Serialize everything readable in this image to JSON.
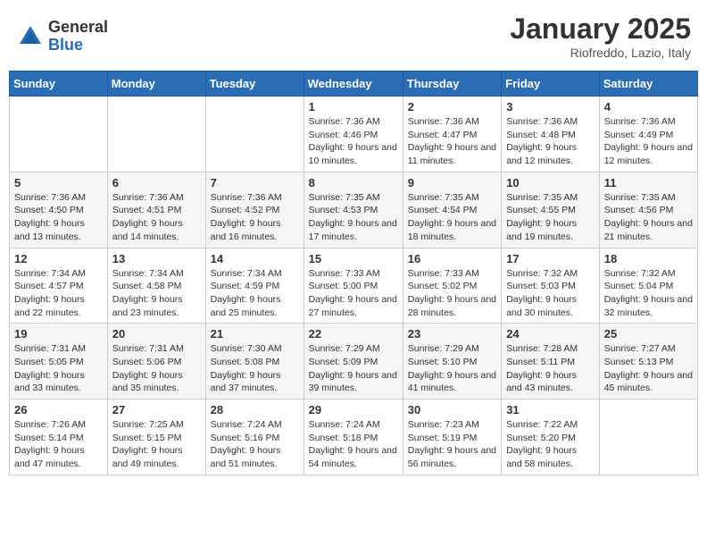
{
  "header": {
    "logo_general": "General",
    "logo_blue": "Blue",
    "month_title": "January 2025",
    "location": "Riofreddo, Lazio, Italy"
  },
  "weekdays": [
    "Sunday",
    "Monday",
    "Tuesday",
    "Wednesday",
    "Thursday",
    "Friday",
    "Saturday"
  ],
  "weeks": [
    [
      {
        "day": "",
        "sunrise": "",
        "sunset": "",
        "daylight": ""
      },
      {
        "day": "",
        "sunrise": "",
        "sunset": "",
        "daylight": ""
      },
      {
        "day": "",
        "sunrise": "",
        "sunset": "",
        "daylight": ""
      },
      {
        "day": "1",
        "sunrise": "Sunrise: 7:36 AM",
        "sunset": "Sunset: 4:46 PM",
        "daylight": "Daylight: 9 hours and 10 minutes."
      },
      {
        "day": "2",
        "sunrise": "Sunrise: 7:36 AM",
        "sunset": "Sunset: 4:47 PM",
        "daylight": "Daylight: 9 hours and 11 minutes."
      },
      {
        "day": "3",
        "sunrise": "Sunrise: 7:36 AM",
        "sunset": "Sunset: 4:48 PM",
        "daylight": "Daylight: 9 hours and 12 minutes."
      },
      {
        "day": "4",
        "sunrise": "Sunrise: 7:36 AM",
        "sunset": "Sunset: 4:49 PM",
        "daylight": "Daylight: 9 hours and 12 minutes."
      }
    ],
    [
      {
        "day": "5",
        "sunrise": "Sunrise: 7:36 AM",
        "sunset": "Sunset: 4:50 PM",
        "daylight": "Daylight: 9 hours and 13 minutes."
      },
      {
        "day": "6",
        "sunrise": "Sunrise: 7:36 AM",
        "sunset": "Sunset: 4:51 PM",
        "daylight": "Daylight: 9 hours and 14 minutes."
      },
      {
        "day": "7",
        "sunrise": "Sunrise: 7:36 AM",
        "sunset": "Sunset: 4:52 PM",
        "daylight": "Daylight: 9 hours and 16 minutes."
      },
      {
        "day": "8",
        "sunrise": "Sunrise: 7:35 AM",
        "sunset": "Sunset: 4:53 PM",
        "daylight": "Daylight: 9 hours and 17 minutes."
      },
      {
        "day": "9",
        "sunrise": "Sunrise: 7:35 AM",
        "sunset": "Sunset: 4:54 PM",
        "daylight": "Daylight: 9 hours and 18 minutes."
      },
      {
        "day": "10",
        "sunrise": "Sunrise: 7:35 AM",
        "sunset": "Sunset: 4:55 PM",
        "daylight": "Daylight: 9 hours and 19 minutes."
      },
      {
        "day": "11",
        "sunrise": "Sunrise: 7:35 AM",
        "sunset": "Sunset: 4:56 PM",
        "daylight": "Daylight: 9 hours and 21 minutes."
      }
    ],
    [
      {
        "day": "12",
        "sunrise": "Sunrise: 7:34 AM",
        "sunset": "Sunset: 4:57 PM",
        "daylight": "Daylight: 9 hours and 22 minutes."
      },
      {
        "day": "13",
        "sunrise": "Sunrise: 7:34 AM",
        "sunset": "Sunset: 4:58 PM",
        "daylight": "Daylight: 9 hours and 23 minutes."
      },
      {
        "day": "14",
        "sunrise": "Sunrise: 7:34 AM",
        "sunset": "Sunset: 4:59 PM",
        "daylight": "Daylight: 9 hours and 25 minutes."
      },
      {
        "day": "15",
        "sunrise": "Sunrise: 7:33 AM",
        "sunset": "Sunset: 5:00 PM",
        "daylight": "Daylight: 9 hours and 27 minutes."
      },
      {
        "day": "16",
        "sunrise": "Sunrise: 7:33 AM",
        "sunset": "Sunset: 5:02 PM",
        "daylight": "Daylight: 9 hours and 28 minutes."
      },
      {
        "day": "17",
        "sunrise": "Sunrise: 7:32 AM",
        "sunset": "Sunset: 5:03 PM",
        "daylight": "Daylight: 9 hours and 30 minutes."
      },
      {
        "day": "18",
        "sunrise": "Sunrise: 7:32 AM",
        "sunset": "Sunset: 5:04 PM",
        "daylight": "Daylight: 9 hours and 32 minutes."
      }
    ],
    [
      {
        "day": "19",
        "sunrise": "Sunrise: 7:31 AM",
        "sunset": "Sunset: 5:05 PM",
        "daylight": "Daylight: 9 hours and 33 minutes."
      },
      {
        "day": "20",
        "sunrise": "Sunrise: 7:31 AM",
        "sunset": "Sunset: 5:06 PM",
        "daylight": "Daylight: 9 hours and 35 minutes."
      },
      {
        "day": "21",
        "sunrise": "Sunrise: 7:30 AM",
        "sunset": "Sunset: 5:08 PM",
        "daylight": "Daylight: 9 hours and 37 minutes."
      },
      {
        "day": "22",
        "sunrise": "Sunrise: 7:29 AM",
        "sunset": "Sunset: 5:09 PM",
        "daylight": "Daylight: 9 hours and 39 minutes."
      },
      {
        "day": "23",
        "sunrise": "Sunrise: 7:29 AM",
        "sunset": "Sunset: 5:10 PM",
        "daylight": "Daylight: 9 hours and 41 minutes."
      },
      {
        "day": "24",
        "sunrise": "Sunrise: 7:28 AM",
        "sunset": "Sunset: 5:11 PM",
        "daylight": "Daylight: 9 hours and 43 minutes."
      },
      {
        "day": "25",
        "sunrise": "Sunrise: 7:27 AM",
        "sunset": "Sunset: 5:13 PM",
        "daylight": "Daylight: 9 hours and 45 minutes."
      }
    ],
    [
      {
        "day": "26",
        "sunrise": "Sunrise: 7:26 AM",
        "sunset": "Sunset: 5:14 PM",
        "daylight": "Daylight: 9 hours and 47 minutes."
      },
      {
        "day": "27",
        "sunrise": "Sunrise: 7:25 AM",
        "sunset": "Sunset: 5:15 PM",
        "daylight": "Daylight: 9 hours and 49 minutes."
      },
      {
        "day": "28",
        "sunrise": "Sunrise: 7:24 AM",
        "sunset": "Sunset: 5:16 PM",
        "daylight": "Daylight: 9 hours and 51 minutes."
      },
      {
        "day": "29",
        "sunrise": "Sunrise: 7:24 AM",
        "sunset": "Sunset: 5:18 PM",
        "daylight": "Daylight: 9 hours and 54 minutes."
      },
      {
        "day": "30",
        "sunrise": "Sunrise: 7:23 AM",
        "sunset": "Sunset: 5:19 PM",
        "daylight": "Daylight: 9 hours and 56 minutes."
      },
      {
        "day": "31",
        "sunrise": "Sunrise: 7:22 AM",
        "sunset": "Sunset: 5:20 PM",
        "daylight": "Daylight: 9 hours and 58 minutes."
      },
      {
        "day": "",
        "sunrise": "",
        "sunset": "",
        "daylight": ""
      }
    ]
  ]
}
